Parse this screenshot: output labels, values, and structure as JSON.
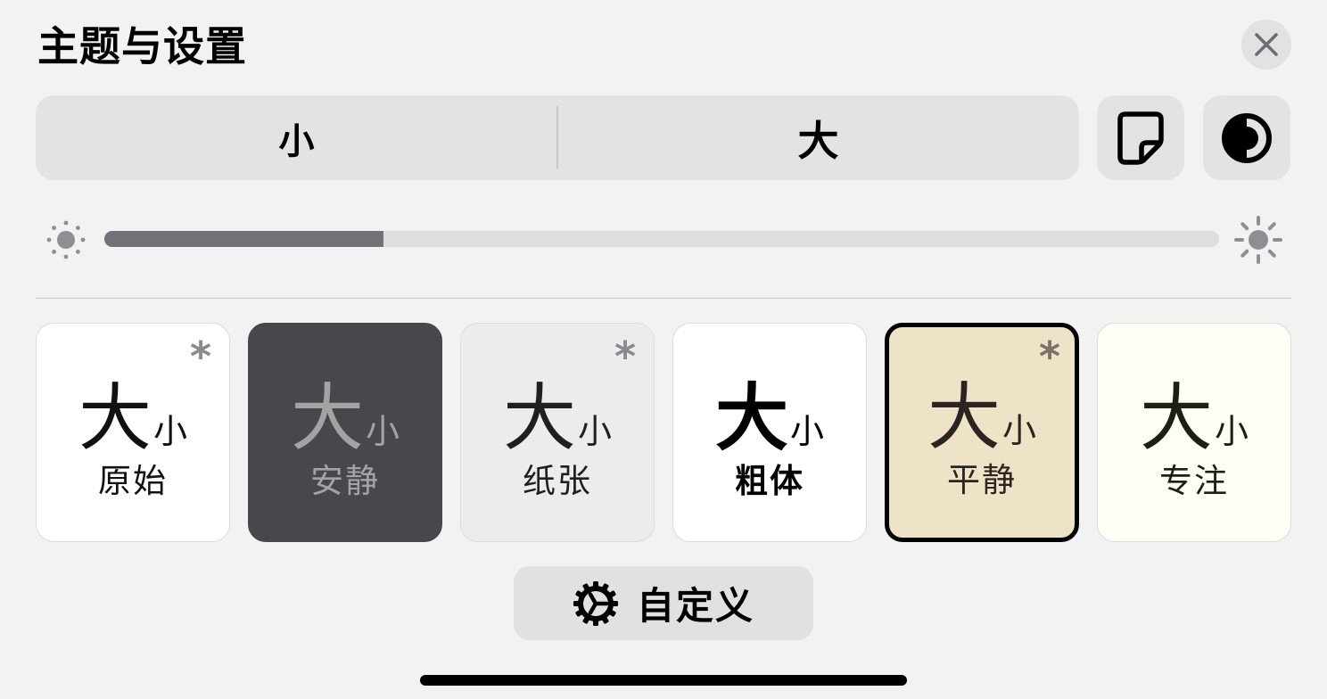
{
  "panel": {
    "title": "主题与设置"
  },
  "font_size_control": {
    "decrease_label": "小",
    "increase_label": "大"
  },
  "icons": {
    "close": "close-icon",
    "page": "page-icon",
    "contrast": "contrast-icon",
    "brightness_low": "sun-small-icon",
    "brightness_high": "sun-large-icon",
    "customize": "gear-icon"
  },
  "brightness": {
    "level": 0.25
  },
  "themes": [
    {
      "sample_big": "大",
      "sample_small": "小",
      "name": "原始",
      "customizable_mark": "*"
    },
    {
      "sample_big": "大",
      "sample_small": "小",
      "name": "安静"
    },
    {
      "sample_big": "大",
      "sample_small": "小",
      "name": "纸张",
      "customizable_mark": "*"
    },
    {
      "sample_big": "大",
      "sample_small": "小",
      "name": "粗体"
    },
    {
      "sample_big": "大",
      "sample_small": "小",
      "name": "平静",
      "customizable_mark": "*",
      "selected": true
    },
    {
      "sample_big": "大",
      "sample_small": "小",
      "name": "专注"
    }
  ],
  "customize_button": {
    "label": "自定义"
  },
  "colors": {
    "background": "#f2f2f2",
    "control": "#e3e3e5",
    "slider_fill": "#727178",
    "theme_quiet": "#48474c",
    "theme_calm": "#efe3c7"
  }
}
